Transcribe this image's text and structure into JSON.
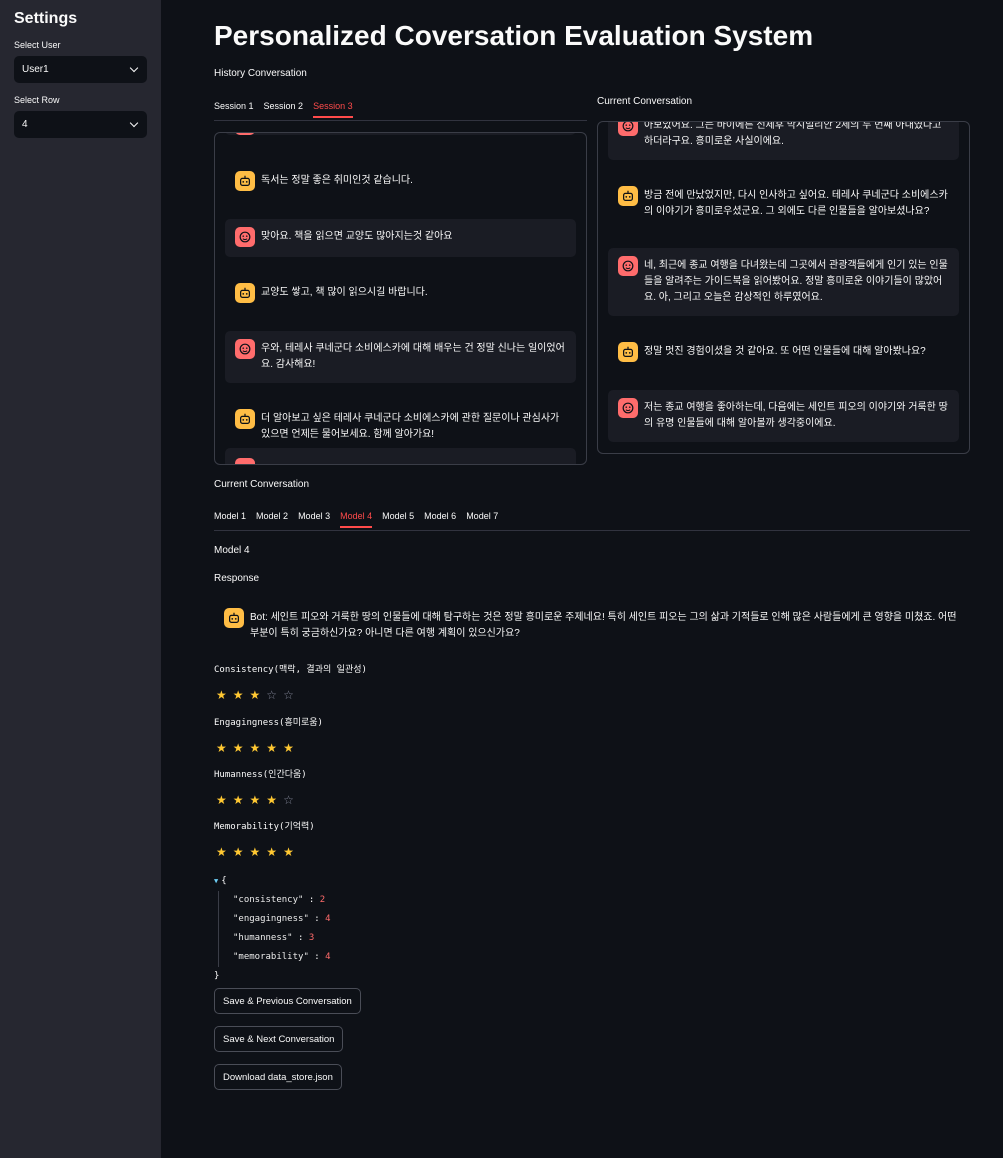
{
  "sidebar": {
    "title": "Settings",
    "user_label": "Select User",
    "user_value": "User1",
    "row_label": "Select Row",
    "row_value": "4"
  },
  "header": {
    "title": "Personalized Coversation Evaluation System"
  },
  "history": {
    "caption": "History Conversation",
    "tabs": [
      "Session 1",
      "Session 2",
      "Session 3"
    ],
    "active_tab": "Session 3",
    "messages": [
      {
        "role": "bot",
        "text": "독서는 정말 좋은 취미인것 같습니다."
      },
      {
        "role": "user",
        "text": "맞아요. 책을 읽으면 교양도 많아지는것 같아요"
      },
      {
        "role": "bot",
        "text": "교양도 쌓고, 책 많이 읽으시길 바랍니다."
      },
      {
        "role": "user",
        "text": "우와, 테레사 쿠네군다 소비에스카에 대해 배우는 건 정말 신나는 일이었어요. 감사해요!"
      },
      {
        "role": "bot",
        "text": "더 알아보고 싶은 테레사 쿠네군다 소비에스카에 관한 질문이나 관심사가 있으면 언제든 물어보세요. 함께 알아가요!"
      }
    ]
  },
  "current": {
    "caption": "Current Conversation",
    "messages": [
      {
        "role": "user",
        "text": "아보았어요. 그는 바이에른 선제후 막시밀리안 2세의 두 번째 아내였다고 하더라구요. 흥미로운 사실이에요."
      },
      {
        "role": "bot",
        "text": "방금 전에 만났었지만, 다시 인사하고 싶어요. 테레사 쿠네군다 소비에스카의 이야기가 흥미로우셨군요. 그 외에도 다른 인물들을 알아보셨나요?"
      },
      {
        "role": "user",
        "text": "네, 최근에 종교 여행을 다녀왔는데 그곳에서 관광객들에게 인기 있는 인물들을 알려주는 가이드북을 읽어봤어요. 정말 흥미로운 이야기들이 많았어요. 아, 그리고 오늘은 감상적인 하루였어요."
      },
      {
        "role": "bot",
        "text": "정말 멋진 경험이셨을 것 같아요. 또 어떤 인물들에 대해 알아봤나요?"
      },
      {
        "role": "user",
        "text": "저는 종교 여행을 좋아하는데, 다음에는 세인트 피오의 이야기와 거룩한 땅의 유명 인물들에 대해 알아볼까 생각중이에요."
      }
    ]
  },
  "models": {
    "caption": "Current Conversation",
    "tabs": [
      "Model 1",
      "Model 2",
      "Model 3",
      "Model 4",
      "Model 5",
      "Model 6",
      "Model 7"
    ],
    "active_tab": "Model 4",
    "selected_label": "Model 4",
    "response_label": "Response",
    "response_text": "Bot: 세인트 피오와 거룩한 땅의 인물들에 대해 탐구하는 것은 정말 흥미로운 주제네요! 특히 세인트 피오는 그의 삶과 기적들로 인해 많은 사람들에게 큰 영향을 미쳤죠. 어떤 부분이 특히 궁금하신가요? 아니면 다른 여행 계획이 있으신가요?"
  },
  "ratings": [
    {
      "label": "Consistency(맥락, 결과의 일관성)",
      "stars": 3,
      "max": 5
    },
    {
      "label": "Engagingness(흥미로움)",
      "stars": 5,
      "max": 5
    },
    {
      "label": "Humanness(인간다움)",
      "stars": 4,
      "max": 5
    },
    {
      "label": "Memorability(기억력)",
      "stars": 5,
      "max": 5
    }
  ],
  "json_output": {
    "open": "{",
    "close": "}",
    "entries": [
      {
        "key": "\"consistency\"",
        "value": "2"
      },
      {
        "key": "\"engagingness\"",
        "value": "4"
      },
      {
        "key": "\"humanness\"",
        "value": "3"
      },
      {
        "key": "\"memorability\"",
        "value": "4"
      }
    ]
  },
  "buttons": {
    "prev": "Save & Previous Conversation",
    "next": "Save & Next Conversation",
    "download": "Download data_store.json"
  },
  "colors": {
    "accent": "#ff4b4b",
    "user_avatar": "#ff6c6c",
    "bot_avatar": "#ffbd45",
    "star": "#ffc832"
  }
}
